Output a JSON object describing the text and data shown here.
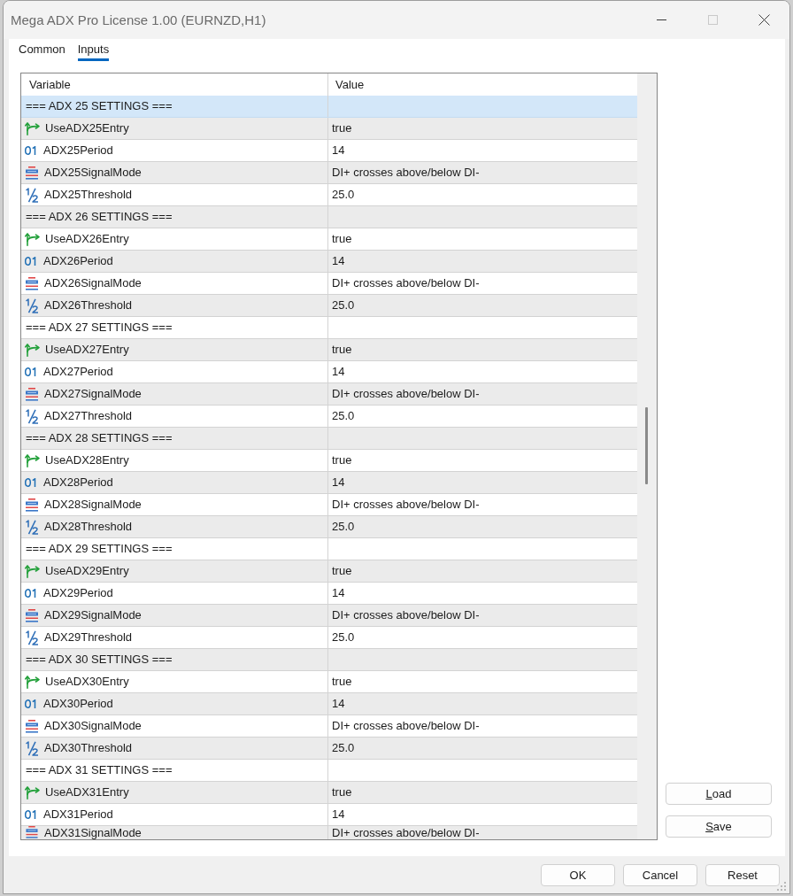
{
  "window": {
    "title": "Mega ADX Pro License 1.00 (EURNZD,H1)",
    "controls": [
      {
        "kind": "minimize",
        "disabled": false
      },
      {
        "kind": "maximize",
        "disabled": true
      },
      {
        "kind": "close",
        "disabled": false
      }
    ]
  },
  "tabs": [
    {
      "label": "Common",
      "selected": false
    },
    {
      "label": "Inputs",
      "selected": true
    }
  ],
  "table": {
    "columns": [
      "Variable",
      "Value"
    ],
    "rows": [
      {
        "kind": "section",
        "variable": "=== ADX 25 SETTINGS ===",
        "selected": true
      },
      {
        "kind": "bool",
        "variable": "UseADX25Entry",
        "value": "true",
        "selected": false
      },
      {
        "kind": "int",
        "variable": "ADX25Period",
        "value": "14",
        "selected": false
      },
      {
        "kind": "enum",
        "variable": "ADX25SignalMode",
        "value": "DI+ crosses above/below DI-",
        "selected": false
      },
      {
        "kind": "double",
        "variable": "ADX25Threshold",
        "value": "25.0",
        "selected": false
      },
      {
        "kind": "section",
        "variable": "=== ADX 26 SETTINGS ===",
        "selected": false
      },
      {
        "kind": "bool",
        "variable": "UseADX26Entry",
        "value": "true",
        "selected": false
      },
      {
        "kind": "int",
        "variable": "ADX26Period",
        "value": "14",
        "selected": false
      },
      {
        "kind": "enum",
        "variable": "ADX26SignalMode",
        "value": "DI+ crosses above/below DI-",
        "selected": false
      },
      {
        "kind": "double",
        "variable": "ADX26Threshold",
        "value": "25.0",
        "selected": false
      },
      {
        "kind": "section",
        "variable": "=== ADX 27 SETTINGS ===",
        "selected": false
      },
      {
        "kind": "bool",
        "variable": "UseADX27Entry",
        "value": "true",
        "selected": false
      },
      {
        "kind": "int",
        "variable": "ADX27Period",
        "value": "14",
        "selected": false
      },
      {
        "kind": "enum",
        "variable": "ADX27SignalMode",
        "value": "DI+ crosses above/below DI-",
        "selected": false
      },
      {
        "kind": "double",
        "variable": "ADX27Threshold",
        "value": "25.0",
        "selected": false
      },
      {
        "kind": "section",
        "variable": "=== ADX 28 SETTINGS ===",
        "selected": false
      },
      {
        "kind": "bool",
        "variable": "UseADX28Entry",
        "value": "true",
        "selected": false
      },
      {
        "kind": "int",
        "variable": "ADX28Period",
        "value": "14",
        "selected": false
      },
      {
        "kind": "enum",
        "variable": "ADX28SignalMode",
        "value": "DI+ crosses above/below DI-",
        "selected": false
      },
      {
        "kind": "double",
        "variable": "ADX28Threshold",
        "value": "25.0",
        "selected": false
      },
      {
        "kind": "section",
        "variable": "=== ADX 29 SETTINGS ===",
        "selected": false
      },
      {
        "kind": "bool",
        "variable": "UseADX29Entry",
        "value": "true",
        "selected": false
      },
      {
        "kind": "int",
        "variable": "ADX29Period",
        "value": "14",
        "selected": false
      },
      {
        "kind": "enum",
        "variable": "ADX29SignalMode",
        "value": "DI+ crosses above/below DI-",
        "selected": false
      },
      {
        "kind": "double",
        "variable": "ADX29Threshold",
        "value": "25.0",
        "selected": false
      },
      {
        "kind": "section",
        "variable": "=== ADX 30 SETTINGS ===",
        "selected": false
      },
      {
        "kind": "bool",
        "variable": "UseADX30Entry",
        "value": "true",
        "selected": false
      },
      {
        "kind": "int",
        "variable": "ADX30Period",
        "value": "14",
        "selected": false
      },
      {
        "kind": "enum",
        "variable": "ADX30SignalMode",
        "value": "DI+ crosses above/below DI-",
        "selected": false
      },
      {
        "kind": "double",
        "variable": "ADX30Threshold",
        "value": "25.0",
        "selected": false
      },
      {
        "kind": "section",
        "variable": "=== ADX 31 SETTINGS ===",
        "selected": false
      },
      {
        "kind": "bool",
        "variable": "UseADX31Entry",
        "value": "true",
        "selected": false
      },
      {
        "kind": "int",
        "variable": "ADX31Period",
        "value": "14",
        "selected": false
      },
      {
        "kind": "enum",
        "variable": "ADX31SignalMode",
        "value": "DI+ crosses above/below DI-",
        "selected": false
      }
    ]
  },
  "side_buttons": [
    {
      "label": "Load",
      "mnemonic": true
    },
    {
      "label": "Save",
      "mnemonic": true
    }
  ],
  "buttons": [
    "OK",
    "Cancel",
    "Reset"
  ]
}
